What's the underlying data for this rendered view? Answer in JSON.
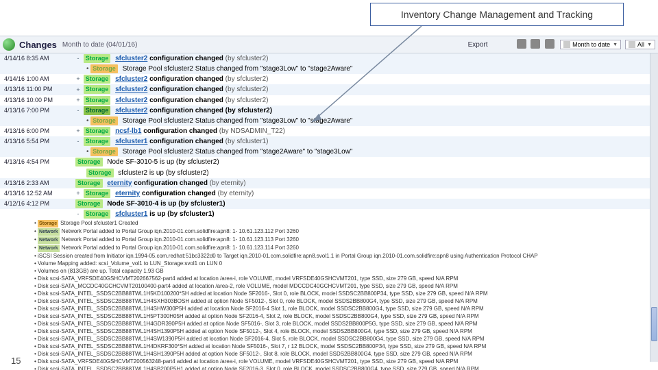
{
  "callout": {
    "text": "Inventory Change Management and Tracking"
  },
  "toolbar": {
    "title": "Changes",
    "subtitle": "Month to date (04/01/16)",
    "export_label": "Export",
    "selector1": "Month to date",
    "selector2": "All"
  },
  "rows": [
    {
      "type": "parent",
      "bg": "blue",
      "time": "4/14/16 8:35 AM",
      "tree": "-",
      "tag": "Storage",
      "link": "sfcluster2",
      "rest": " configuration changed",
      "by": "(by sfcluster2)"
    },
    {
      "type": "child",
      "text": "Storage Pool sfcluster2 Status changed from \"stage3Low\" to \"stage2Aware\"",
      "tag": "Storage"
    },
    {
      "type": "parent",
      "bg": "white",
      "time": "4/14/16 1:00 AM",
      "tree": "+",
      "tag": "Storage",
      "link": "sfcluster2",
      "rest": " configuration changed",
      "by": "(by sfcluster2)"
    },
    {
      "type": "parent",
      "bg": "blue",
      "time": "4/13/16 11:00 PM",
      "tree": "+",
      "tag": "Storage",
      "link": "sfcluster2",
      "rest": " configuration changed",
      "by": "(by sfcluster2)"
    },
    {
      "type": "parent",
      "bg": "white",
      "time": "4/13/16 10:00 PM",
      "tree": "+",
      "tag": "Storage",
      "link": "sfcluster2",
      "rest": " configuration changed",
      "by": "(by sfcluster2)"
    },
    {
      "type": "parent",
      "bg": "blue",
      "time": "4/13/16 7:00 PM",
      "tree": "-",
      "tag": "Storage",
      "link": "sfcluster2",
      "rest": " configuration changed",
      "by": "(by sfcluster2)"
    },
    {
      "type": "child",
      "text": "Storage Pool sfcluster2 Status changed from \"stage3Low\" to \"stage2Aware\"",
      "tag": "Storage"
    },
    {
      "type": "parent",
      "bg": "white",
      "time": "4/13/16 6:00 PM",
      "tree": "+",
      "tag": "Storage",
      "link": "ncsf-lb1",
      "rest": " configuration changed",
      "by": "(by NDSADMIN_T22)"
    },
    {
      "type": "parent",
      "bg": "blue",
      "time": "4/13/16 5:54 PM",
      "tree": "-",
      "tag": "Storage",
      "link": "sfcluster1",
      "rest": " configuration changed",
      "by": "(by sfcluster1)"
    },
    {
      "type": "child",
      "text": "Storage Pool sfcluster2 Status changed from \"stage2Aware\" to \"stage3Low\"",
      "tag": "Storage"
    },
    {
      "type": "parent",
      "bg": "white",
      "time": "4/13/16 4:54 PM",
      "tree": "",
      "tag": "Storage",
      "text2": "Node SF-3010-5 is up (by sfcluster2)"
    },
    {
      "type": "sub",
      "tag": "Storage",
      "text": "sfcluster2 is up (by sfcluster2)"
    },
    {
      "type": "parent",
      "bg": "blue",
      "time": "4/13/16 2:33 AM",
      "tree": "",
      "tag": "Storage",
      "link": "eternity",
      "rest": " configuration changed",
      "by": "(by eternity)"
    },
    {
      "type": "parent",
      "bg": "white",
      "time": "4/13/16 12:52 AM",
      "tree": "+",
      "tag": "Storage",
      "link": "eternity",
      "rest": " configuration changed",
      "by": "(by eternity)"
    },
    {
      "type": "parent",
      "bg": "blue",
      "time": "4/12/16 4:12 PM",
      "tree": "",
      "tag": "Storage",
      "text2": "Node SF-3010-4 is up (by sfcluster1)"
    },
    {
      "type": "parent",
      "bg": "white",
      "time": "",
      "tree": "-",
      "tag": "Storage",
      "link": "sfcluster1",
      "rest": " is up",
      "by": "(by sfcluster1)"
    }
  ],
  "bullets": [
    "Storage Pool sfcluster1 Created",
    "Network Portal added to Portal Group iqn.2010-01.com.solidfire:apn8: 1- 10.61.123.112 Port 3260",
    "Network Portal added to Portal Group iqn.2010-01.com.solidfire:apn8: 1- 10.61.123.113 Port 3260",
    "Network Portal added to Portal Group iqn.2010-01.com.solidfire:apn8: 1- 10.61.123.114 Port 3260",
    "iSCSI Session created from Initiator iqn.1994-05.com.redhat:51bc3322d0 to Target iqn.2010-01.com.solidfire:apn8.svol1.1 in Portal Group iqn.2010-01.com.solidfire:apn8 using Authentication Protocol CHAP",
    "Volume Mapping added: scsi_Volume_vol1 to LUN_Storage:svol1 on LUN 0",
    "Volumes on (813GB) are up. Total capacity 1.93 GB",
    "Disk scsi-SATA_VRFSDE40GSHCVMT202667562-part4 added at location /area-i, role VOLUME, model VRFSDE40GSHCVMT201, type SSD, size 279 GB, speed N/A RPM",
    "Disk scsi-SATA_MCCDC40GCHCVMT20100400-part4 added at location /area-2, role VOLUME, model MDCCDC40GCHCVMT201, type SSD, size 279 GB, speed N/A RPM",
    "Disk scsi-SATA_INTEL_SSDSC2BB88TWL1H5KD100200*SH added at location Node SF2016-, Slot 0, role BLOCK, model SSDSC2BB800P34, type SSD, size 279 GB, speed N/A RPM",
    "Disk scsi-SATA_INTEL_SSDSC2BB88TWL1H4SXH303BOSH added at option Node SF5012-, Slot 0, role BLOCK, model SSDS2BB800G4, type SSD, size 279 GB, speed N/A RPM",
    "Disk scsi-SATA_INTEL_SSDSC2BB88TWL1H4SHW300P5H added at location Node SF2016-4 Slot 1, role BLOCK, model SSDSC2BB800G4, type SSD, size 279 GB, speed N/A RPM",
    "Disk scsi-SATA_INTEL_SSDSC2BB88TWL1H5PT300H05H added at option Node SF2016-4, Slot 2, role BLOCK, model SSDSC2BB800G4, type SSD, size 279 GB, speed N/A RPM",
    "Disk scsi-SATA_INTEL_SSDSC2BB88TWL1H4GDR390P5H added at option Node SF5016-, Slot 3, role BLOCK, model SSDS2BB800P5G, type SSD, size 279 GB, speed N/A RPM",
    "Disk scsi-SATA_INTEL_SSDSC2BB88TWL1H4SH1390P5H added at option Node SF5012-, Slot 4, role BLOCK, model SSDS2BB800G4, type SSD, size 279 GB, speed N/A RPM",
    "Disk scsi-SATA_INTEL_SSDSC2BB88TWL1H4SW1390P5H added at location Node SF2016-4, Slot 5, role BLOCK, model SSDSC2BB800G4, type SSD, size 279 GB, speed N/A RPM",
    "Disk scsi-SATA_INTEL_SSDSC2BB88TWL1H4DKRF300*SH added at location Node SF5016-, Slot 7, r 12 BLOCK, model SSDSC2BB800P34, type SSD, size 279 GB, speed N/A RPM",
    "Disk scsi-SATA_INTEL_SSDSC2BB88TWL1H4SH1390P5H added at option Node SF5012-, Slot 8, role BLOCK, model SSDS2BB800G4, type SSD, size 279 GB, speed N/A RPM",
    "Disk scsi-SATA_VRFSDE40GSHCVMT200563248-part4 added at location /area-i, role VOLUME, model VRFSDE40GSHCVMT201, type SSD, size 279 GB, speed N/A RPM",
    "Disk scsi-SATA_INTEL_SSDSC2BB88TWL1H4SB200P5H1 added at option Node SF2016-3, Slot 0, role BLOCK, model SSDSC2BB800G4, type SSD, size 279 GB, speed N/A RPM"
  ],
  "slide_num": "15"
}
